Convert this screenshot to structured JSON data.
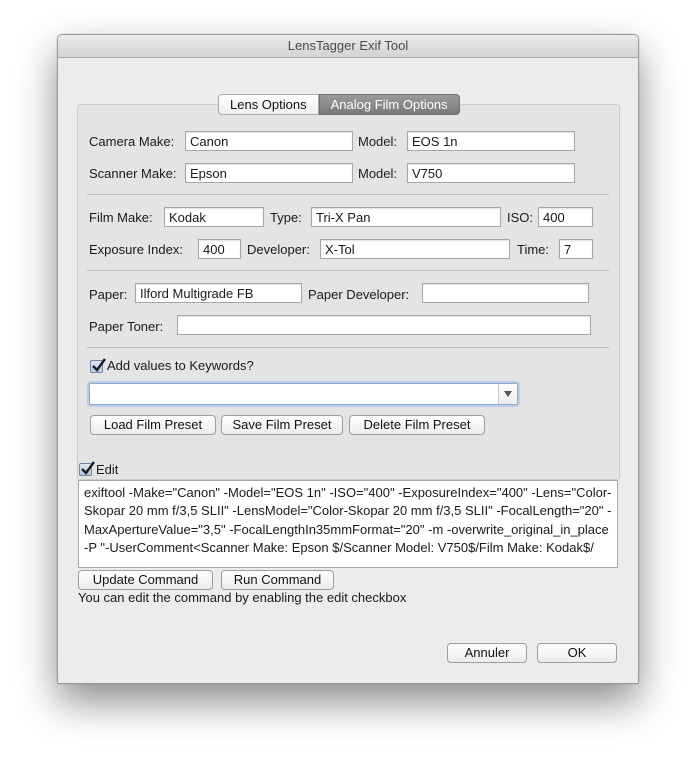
{
  "window": {
    "title": "LensTagger Exif Tool"
  },
  "tabs": {
    "lens": "Lens Options",
    "film": "Analog Film Options"
  },
  "camera": {
    "make_label": "Camera Make:",
    "make_value": "Canon",
    "model_label": "Model:",
    "model_value": "EOS 1n"
  },
  "scanner": {
    "make_label": "Scanner Make:",
    "make_value": "Epson",
    "model_label": "Model:",
    "model_value": "V750"
  },
  "film": {
    "make_label": "Film Make:",
    "make_value": "Kodak",
    "type_label": "Type:",
    "type_value": "Tri-X Pan",
    "iso_label": "ISO:",
    "iso_value": "400",
    "ei_label": "Exposure Index:",
    "ei_value": "400",
    "developer_label": "Developer:",
    "developer_value": "X-Tol",
    "time_label": "Time:",
    "time_value": "7"
  },
  "paper": {
    "paper_label": "Paper:",
    "paper_value": "Ilford Multigrade FB",
    "developer_label": "Paper Developer:",
    "developer_value": "",
    "toner_label": "Paper Toner:",
    "toner_value": ""
  },
  "keywords": {
    "label": "Add values to Keywords?",
    "checked": true
  },
  "preset_combo": {
    "value": ""
  },
  "preset_buttons": {
    "load": "Load Film Preset",
    "save": "Save Film Preset",
    "delete": "Delete Film Preset"
  },
  "edit": {
    "label": "Edit",
    "checked": true
  },
  "command_text": "exiftool  -Make=\"Canon\" -Model=\"EOS 1n\" -ISO=\"400\" -ExposureIndex=\"400\" -Lens=\"Color-Skopar 20 mm f/3,5 SLII\" -LensModel=\"Color-Skopar 20 mm f/3,5 SLII\" -FocalLength=\"20\" -MaxApertureValue=\"3,5\" -FocalLengthIn35mmFormat=\"20\" -m -overwrite_original_in_place -P \"-UserComment<Scanner Make: Epson $/Scanner Model: V750$/Film Make: Kodak$/",
  "command_buttons": {
    "update": "Update Command",
    "run": "Run Command"
  },
  "hint": "You can edit the command by enabling the edit checkbox",
  "dialog_buttons": {
    "cancel": "Annuler",
    "ok": "OK"
  }
}
